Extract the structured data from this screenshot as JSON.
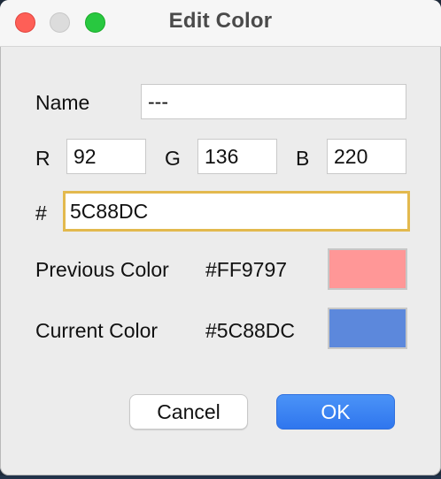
{
  "window": {
    "title": "Edit Color"
  },
  "form": {
    "name_label": "Name",
    "name_value": "---",
    "r_label": "R",
    "r_value": "92",
    "g_label": "G",
    "g_value": "136",
    "b_label": "B",
    "b_value": "220",
    "hex_label": "#",
    "hex_value": "5C88DC"
  },
  "colors": {
    "previous_label": "Previous Color",
    "previous_hex": "#FF9797",
    "previous_swatch": "#FF9797",
    "current_label": "Current Color",
    "current_hex": "#5C88DC",
    "current_swatch": "#5C88DC"
  },
  "buttons": {
    "cancel_label": "Cancel",
    "ok_label": "OK"
  }
}
